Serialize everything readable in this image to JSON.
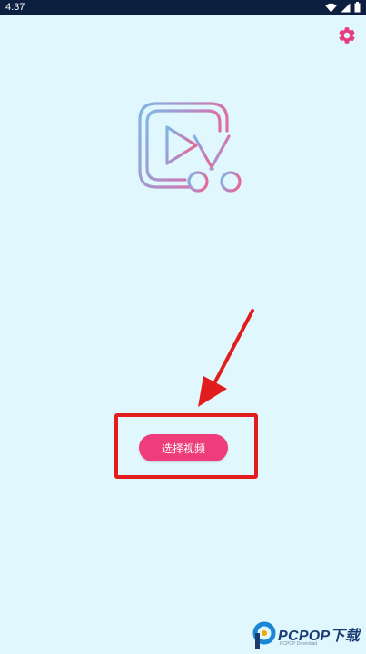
{
  "status_bar": {
    "time": "4:37",
    "background": "#0d1f3e",
    "icons": [
      "wifi-icon",
      "signal-icon",
      "battery-icon"
    ]
  },
  "toolbar": {
    "settings_icon": "gear-icon",
    "settings_color": "#e83b7f"
  },
  "logo": {
    "icon": "video-cut-icon",
    "gradient": [
      "#7fb6e6",
      "#e36b9c"
    ]
  },
  "main": {
    "select_button_label": "选择视频",
    "button_color": "#ee3d7a",
    "highlight_color": "#e11d1d",
    "arrow_color": "#e11d1d"
  },
  "watermark": {
    "brand": "PCPOP下载",
    "sub": "PCPOP Download"
  }
}
